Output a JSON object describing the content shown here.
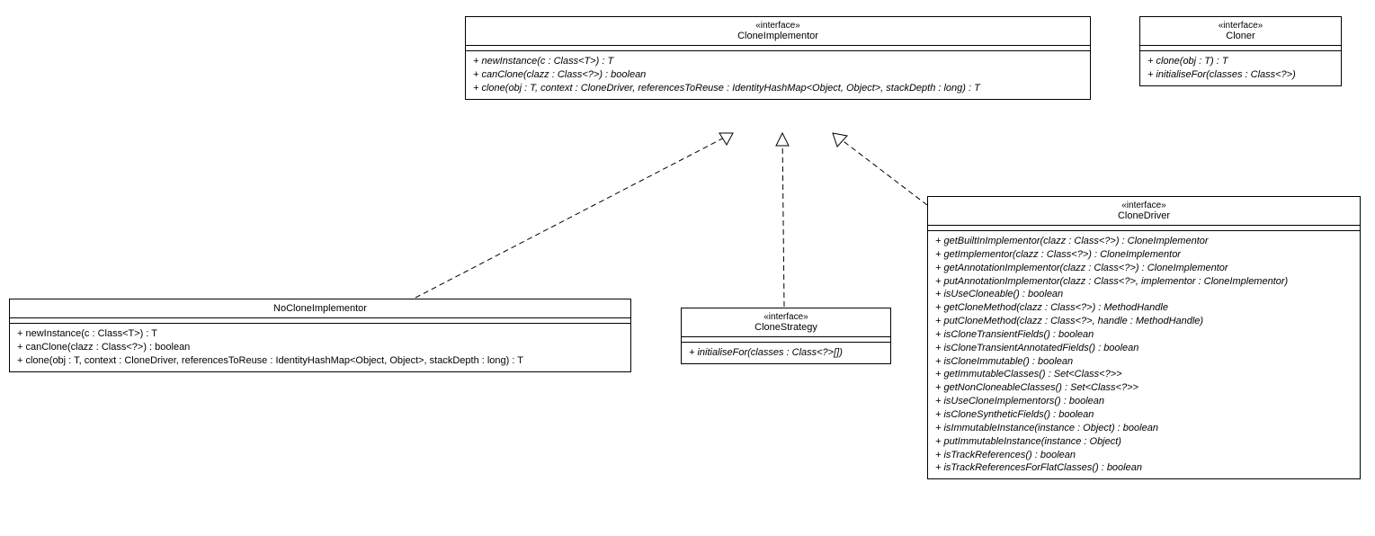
{
  "stereotype": "«interface»",
  "classes": {
    "cloneImplementor": {
      "name": "CloneImplementor",
      "methods": [
        "+ newInstance(c : Class<T>) : T",
        "+ canClone(clazz : Class<?>) : boolean",
        "+ clone(obj : T, context : CloneDriver, referencesToReuse : IdentityHashMap<Object, Object>, stackDepth : long) : T"
      ]
    },
    "cloner": {
      "name": "Cloner",
      "methods": [
        "+ clone(obj : T) : T",
        "+ initialiseFor(classes : Class<?>)"
      ]
    },
    "noCloneImplementor": {
      "name": "NoCloneImplementor",
      "methods": [
        "+ newInstance(c : Class<T>) : T",
        "+ canClone(clazz : Class<?>) : boolean",
        "+ clone(obj : T, context : CloneDriver, referencesToReuse : IdentityHashMap<Object, Object>, stackDepth : long) : T"
      ]
    },
    "cloneStrategy": {
      "name": "CloneStrategy",
      "methods": [
        "+ initialiseFor(classes : Class<?>[])"
      ]
    },
    "cloneDriver": {
      "name": "CloneDriver",
      "methods": [
        "+ getBuiltInImplementor(clazz : Class<?>) : CloneImplementor",
        "+ getImplementor(clazz : Class<?>) : CloneImplementor",
        "+ getAnnotationImplementor(clazz : Class<?>) : CloneImplementor",
        "+ putAnnotationImplementor(clazz : Class<?>, implementor : CloneImplementor)",
        "+ isUseCloneable() : boolean",
        "+ getCloneMethod(clazz : Class<?>) : MethodHandle",
        "+ putCloneMethod(clazz : Class<?>, handle : MethodHandle)",
        "+ isCloneTransientFields() : boolean",
        "+ isCloneTransientAnnotatedFields() : boolean",
        "+ isCloneImmutable() : boolean",
        "+ getImmutableClasses() : Set<Class<?>>",
        "+ getNonCloneableClasses() : Set<Class<?>>",
        "+ isUseCloneImplementors() : boolean",
        "+ isCloneSyntheticFields() : boolean",
        "+ isImmutableInstance(instance : Object) : boolean",
        "+ putImmutableInstance(instance : Object)",
        "+ isTrackReferences() : boolean",
        "+ isTrackReferencesForFlatClasses() : boolean"
      ]
    }
  }
}
